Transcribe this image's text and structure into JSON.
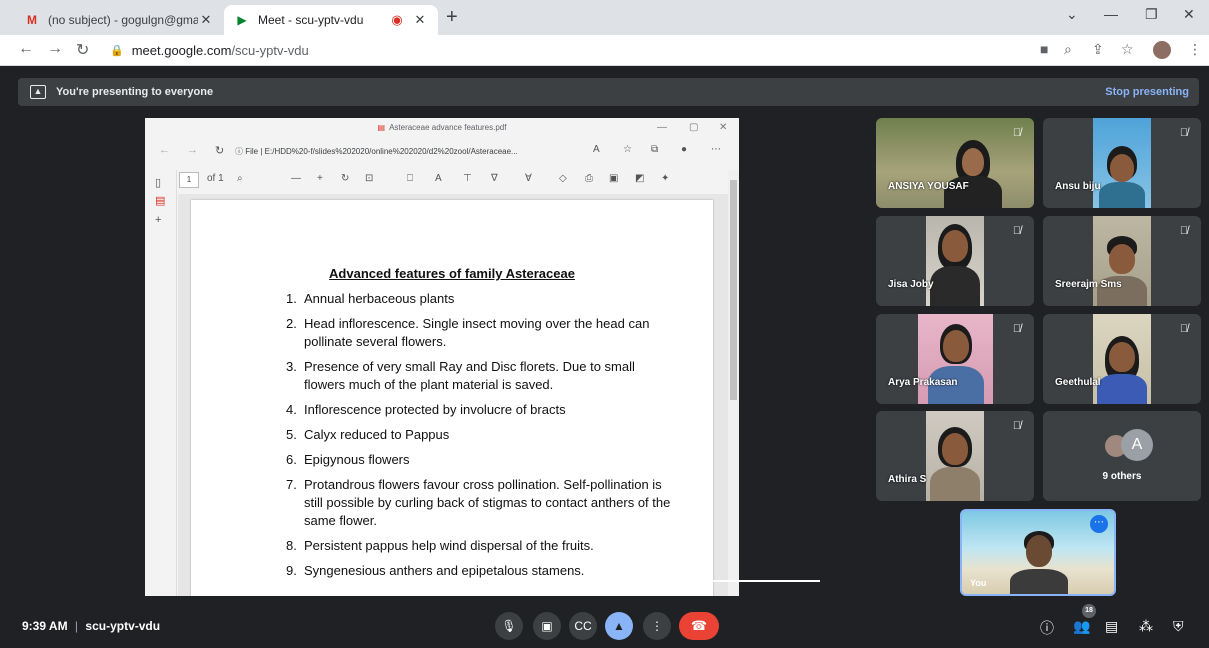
{
  "browser": {
    "tabs": [
      {
        "title": "(no subject) - gogulgn@gmail.co",
        "favicon": "gmail-icon",
        "active": false
      },
      {
        "title": "Meet - scu-yptv-vdu",
        "favicon": "meet-icon",
        "active": true,
        "recording": true
      }
    ],
    "url_host": "meet.google.com",
    "url_path": "/scu-yptv-vdu"
  },
  "banner": {
    "message": "You're presenting to everyone",
    "stop_label": "Stop presenting"
  },
  "viewer": {
    "file_title": "Asteraceae advance features.pdf",
    "file_label": "File",
    "file_url": "E:/HDD%20-f/slides%202020/online%202020/d2%20zool/Asteraceae...",
    "page_current": "1",
    "page_total": "of 1"
  },
  "document": {
    "title": "Advanced features of family Asteraceae",
    "items": [
      {
        "num": "1.",
        "text": "Annual herbaceous plants"
      },
      {
        "num": "2.",
        "text": "Head inflorescence. Single insect moving over the head can pollinate several flowers."
      },
      {
        "num": "3.",
        "text": "Presence of very small Ray and Disc florets. Due to small flowers much of the plant material is saved."
      },
      {
        "num": "4.",
        "text": "Inflorescence protected by involucre of bracts"
      },
      {
        "num": "5.",
        "text": "Calyx reduced to Pappus"
      },
      {
        "num": "6.",
        "text": "Epigynous flowers"
      },
      {
        "num": "7.",
        "text": "Protandrous flowers favour cross pollination. Self-pollination is still possible by curling back of stigmas to contact anthers of the same flower."
      },
      {
        "num": "8.",
        "text": "Persistent pappus help wind dispersal of the fruits."
      },
      {
        "num": "9.",
        "text": "Syngenesious anthers and epipetalous stamens."
      }
    ]
  },
  "participants": [
    {
      "name": "ANSIYA YOUSAF"
    },
    {
      "name": "Ansu biju"
    },
    {
      "name": "Jisa Joby"
    },
    {
      "name": "Sreerajm Sms"
    },
    {
      "name": "Arya Prakasan"
    },
    {
      "name": "Geethulal"
    },
    {
      "name": "Athira S"
    }
  ],
  "others": {
    "avatar_letter": "A",
    "label": "9 others"
  },
  "self_view": {
    "label": "You"
  },
  "bottom": {
    "time": "9:39 AM",
    "separator": "|",
    "meeting_code": "scu-yptv-vdu",
    "participant_count": "18"
  },
  "colors": {
    "meet_bg": "#202124",
    "tile_bg": "#3c4043",
    "accent_blue": "#8ab4f8",
    "hangup_red": "#ea4335"
  }
}
